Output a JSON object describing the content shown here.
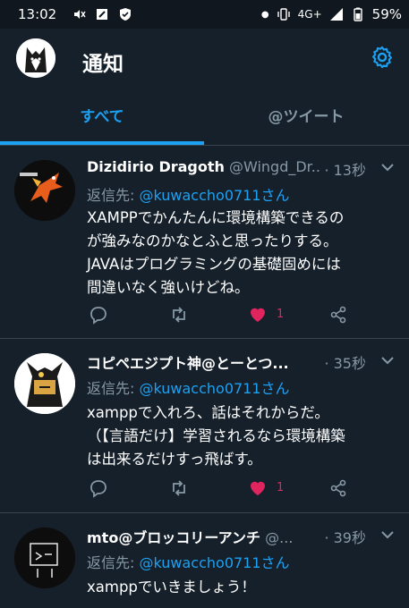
{
  "status_bar": {
    "time": "13:02",
    "network": "4G+",
    "battery": "59%"
  },
  "header": {
    "title": "通知"
  },
  "tabs": [
    {
      "label": "すべて"
    },
    {
      "label": "@ツイート"
    }
  ],
  "tweets": [
    {
      "name": "Dizidirio Dragoth",
      "handle": "@Wingd_Dr...",
      "time": "· 13秒",
      "reply_prefix": "返信先: ",
      "reply_to": "@kuwaccho0711さん",
      "lines": [
        "XAMPPでかんたんに環境構築できるの",
        "が強みなのかなとふと思ったりする。",
        "JAVAはプログラミングの基礎固めには",
        "間違いなく強いけどね。"
      ],
      "likes": "1"
    },
    {
      "name": "コピペエジプト神@とーとつ...",
      "handle": "",
      "time": "· 35秒",
      "reply_prefix": "返信先: ",
      "reply_to": "@kuwaccho0711さん",
      "lines": [
        "xamppで入れろ、話はそれからだ。",
        "（【言語だけ】学習されるなら環境構築",
        "は出来るだけすっ飛ばす。"
      ],
      "likes": "1"
    },
    {
      "name": "mto@ブロッコリーアンチ",
      "handle": "@...",
      "time": "· 39秒",
      "reply_prefix": "返信先: ",
      "reply_to": "@kuwaccho0711さん",
      "lines": [
        "xamppでいきましょう！"
      ],
      "likes": ""
    }
  ],
  "colors": {
    "accent": "#1da1f2",
    "like": "#e0245e",
    "background": "#15202b",
    "muted": "#8899a6"
  }
}
